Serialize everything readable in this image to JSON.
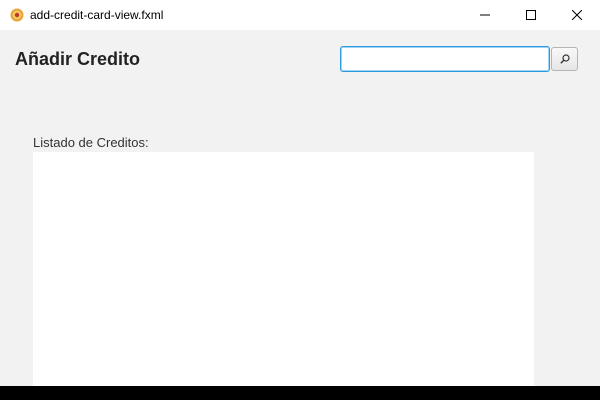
{
  "window": {
    "title": "add-credit-card-view.fxml",
    "app_icon": "javafx-app-icon",
    "controls": {
      "minimize_icon": "minimize-icon",
      "maximize_icon": "maximize-icon",
      "close_icon": "close-icon"
    }
  },
  "header": {
    "title": "Añadir Credito"
  },
  "search": {
    "value": "",
    "placeholder": "",
    "button_icon": "search-icon"
  },
  "credits": {
    "label": "Listado de Creditos:",
    "items": []
  },
  "colors": {
    "window_background": "#f2f2f2",
    "titlebar_background": "#ffffff",
    "focus_accent": "#2e9be0",
    "list_background": "#ffffff",
    "icon_orange": "#f39c12"
  }
}
